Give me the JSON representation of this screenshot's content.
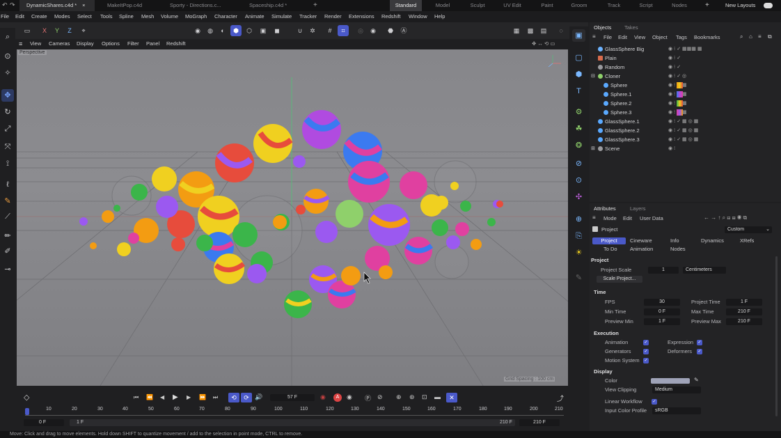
{
  "file_tabs": [
    {
      "label": "DynamicShares.c4d *",
      "active": true
    },
    {
      "label": "MakeItPop.c4d",
      "active": false
    },
    {
      "label": "Sporty - Directions.c...",
      "active": false
    },
    {
      "label": "Spaceship.c4d *",
      "active": false
    }
  ],
  "layouts": [
    "Standard",
    "Model",
    "Sculpt",
    "UV Edit",
    "Paint",
    "Groom",
    "Track",
    "Script",
    "Nodes"
  ],
  "new_layouts": "New Layouts",
  "menu": [
    "File",
    "Edit",
    "Create",
    "Modes",
    "Select",
    "Tools",
    "Spline",
    "Mesh",
    "Volume",
    "MoGraph",
    "Character",
    "Animate",
    "Simulate",
    "Tracker",
    "Render",
    "Extensions",
    "Redshift",
    "Window",
    "Help"
  ],
  "toolbar": {
    "axis_x": "X",
    "axis_y": "Y",
    "axis_z": "Z"
  },
  "viewport_menu": [
    "View",
    "Cameras",
    "Display",
    "Options",
    "Filter",
    "Panel",
    "Redshift"
  ],
  "viewport": {
    "label": "Perspective",
    "grid_spacing": "Grid Spacing : 100 cm"
  },
  "timeline": {
    "current_frame": "57 F",
    "ticks": [
      "10",
      "20",
      "30",
      "40",
      "50",
      "60",
      "70",
      "80",
      "90",
      "100",
      "110",
      "120",
      "130",
      "140",
      "150",
      "160",
      "170",
      "180",
      "190",
      "200",
      "210"
    ],
    "start_field": "0 F",
    "range_start": "1 F",
    "range_end": "210 F",
    "end_field": "210 F"
  },
  "status": "Move: Click and drag to move elements. Hold down SHIFT to quantize movement / add to the selection in point mode, CTRL to remove.",
  "objects_panel": {
    "tabs": [
      "Objects",
      "Takes"
    ],
    "menu": [
      "File",
      "Edit",
      "View",
      "Object",
      "Tags",
      "Bookmarks"
    ],
    "rows": [
      {
        "name": "GlassSphere Big",
        "indent": 0,
        "color": "#6db3ff"
      },
      {
        "name": "Plain",
        "indent": 0,
        "color": "#d86b4c"
      },
      {
        "name": "Random",
        "indent": 0,
        "color": "#9a9a9e"
      },
      {
        "name": "Cloner",
        "indent": 0,
        "color": "#8fd06b"
      },
      {
        "name": "Sphere",
        "indent": 1,
        "color": "#5aa9ff"
      },
      {
        "name": "Sphere.1",
        "indent": 1,
        "color": "#5aa9ff"
      },
      {
        "name": "Sphere.2",
        "indent": 1,
        "color": "#5aa9ff"
      },
      {
        "name": "Sphere.3",
        "indent": 1,
        "color": "#5aa9ff"
      },
      {
        "name": "GlassSphere.1",
        "indent": 0,
        "color": "#5aa9ff"
      },
      {
        "name": "GlassSphere.2",
        "indent": 0,
        "color": "#5aa9ff"
      },
      {
        "name": "GlassSphere.3",
        "indent": 0,
        "color": "#5aa9ff"
      },
      {
        "name": "Scene",
        "indent": 0,
        "color": "#9a9a9e"
      }
    ]
  },
  "attributes": {
    "tabs": [
      "Attributes",
      "Layers"
    ],
    "menu": [
      "Mode",
      "Edit",
      "User Data"
    ],
    "object": "Project",
    "preset": "Custom",
    "subtabs": [
      "Project",
      "Cineware",
      "Info",
      "Dynamics",
      "XRefs",
      "To Do",
      "Animation",
      "Nodes"
    ],
    "section_project": "Project",
    "project_scale_label": "Project Scale",
    "project_scale": "1",
    "project_scale_unit": "Centimeters",
    "scale_project_btn": "Scale Project...",
    "section_time": "Time",
    "fps_label": "FPS",
    "fps": "30",
    "project_time_label": "Project Time",
    "project_time": "1 F",
    "min_time_label": "Min Time",
    "min_time": "0 F",
    "max_time_label": "Max Time",
    "max_time": "210 F",
    "preview_min_label": "Preview Min",
    "preview_min": "1 F",
    "preview_max_label": "Preview Max",
    "preview_max": "210 F",
    "section_execution": "Execution",
    "animation_label": "Animation",
    "expression_label": "Expression",
    "generators_label": "Generators",
    "deformers_label": "Deformers",
    "motion_system_label": "Motion System",
    "section_display": "Display",
    "color_label": "Color",
    "view_clipping_label": "View Clipping",
    "view_clipping": "Medium",
    "linear_workflow_label": "Linear Workflow",
    "input_color_profile_label": "Input Color Profile",
    "input_color_profile": "sRGB"
  },
  "colors": {
    "accent": "#4a59c9",
    "bg": "#1f1f21",
    "viewport": "#88888c"
  }
}
